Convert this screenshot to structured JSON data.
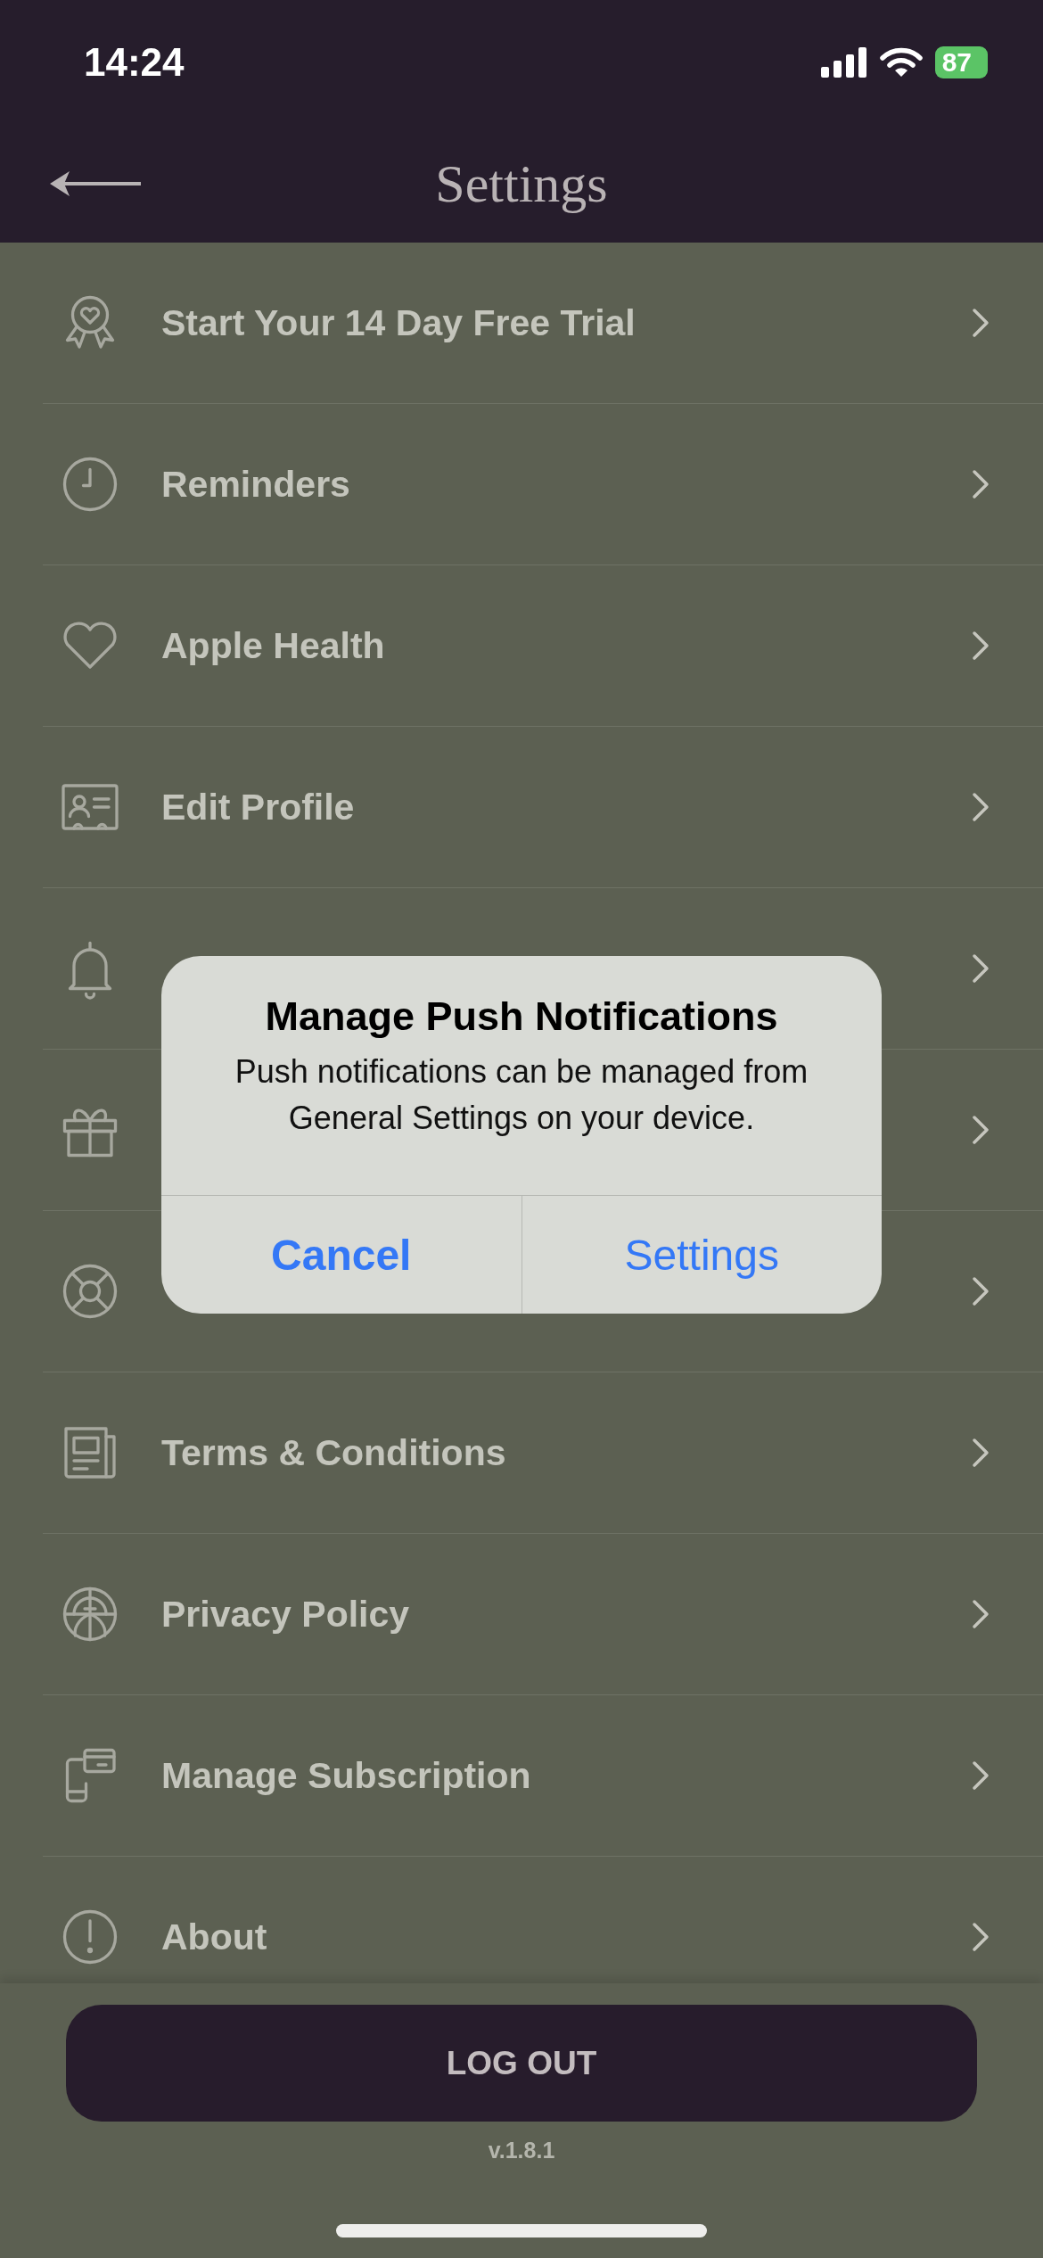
{
  "status_bar": {
    "time": "14:24",
    "battery": "87"
  },
  "header": {
    "title": "Settings"
  },
  "rows": [
    {
      "label": "Start Your 14 Day Free Trial"
    },
    {
      "label": "Reminders"
    },
    {
      "label": "Apple Health"
    },
    {
      "label": "Edit Profile"
    },
    {},
    {},
    {},
    {
      "label": "Terms & Conditions"
    },
    {
      "label": "Privacy Policy"
    },
    {
      "label": "Manage Subscription"
    },
    {
      "label": "About"
    }
  ],
  "dialog": {
    "title": "Manage Push Notifications",
    "message": "Push notifications can be managed from General Settings on your device.",
    "buttons": [
      {
        "label": "Cancel",
        "kind": "cancel"
      },
      {
        "label": "Settings",
        "kind": "default"
      }
    ]
  },
  "logout_button": "LOG OUT",
  "version": "v.1.8.1"
}
